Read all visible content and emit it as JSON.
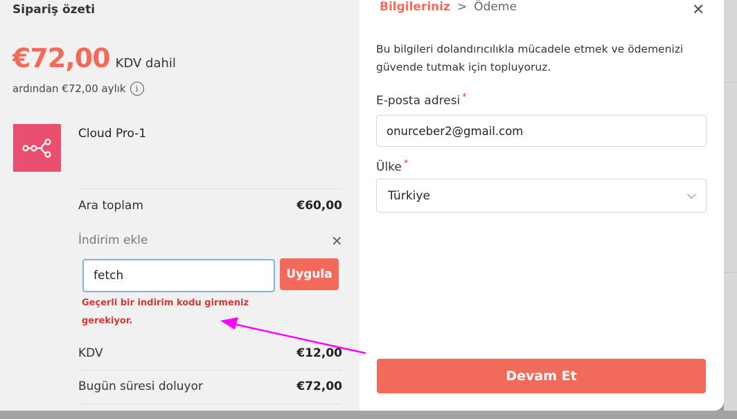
{
  "summary": {
    "title": "Sipariş özeti",
    "price": "€72,00",
    "price_note": "KDV dahil",
    "after_text": "ardından €72,00 aylık",
    "product_name": "Cloud Pro-1",
    "product_icon": "workflow-nodes-icon",
    "subtotal_label": "Ara toplam",
    "subtotal_value": "€60,00",
    "discount_label": "İndirim ekle",
    "discount_code": "fetch",
    "apply_label": "Uygula",
    "error_text": "Geçerli bir indirim kodu girmeniz gerekiyor.",
    "tax_label": "KDV",
    "tax_value": "€12,00",
    "due_label": "Bugün süresi doluyor",
    "due_value": "€72,00"
  },
  "checkout": {
    "crumb_active": "Bilgileriniz",
    "crumb_sep": ">",
    "crumb_next": "Ödeme",
    "intro": "Bu bilgileri dolandırıcılıkla mücadele etmek ve ödemenizi güvende tutmak için topluyoruz.",
    "email_label": "E-posta adresi",
    "email_value": "onurceber2@gmail.com",
    "country_label": "Ülke",
    "country_value": "Türkiye",
    "required_mark": "*",
    "continue_label": "Devam Et"
  },
  "colors": {
    "accent": "#f26b5a",
    "error": "#d23838",
    "product_tile": "#e9506f",
    "annotation_arrow": "#ff00ff"
  }
}
